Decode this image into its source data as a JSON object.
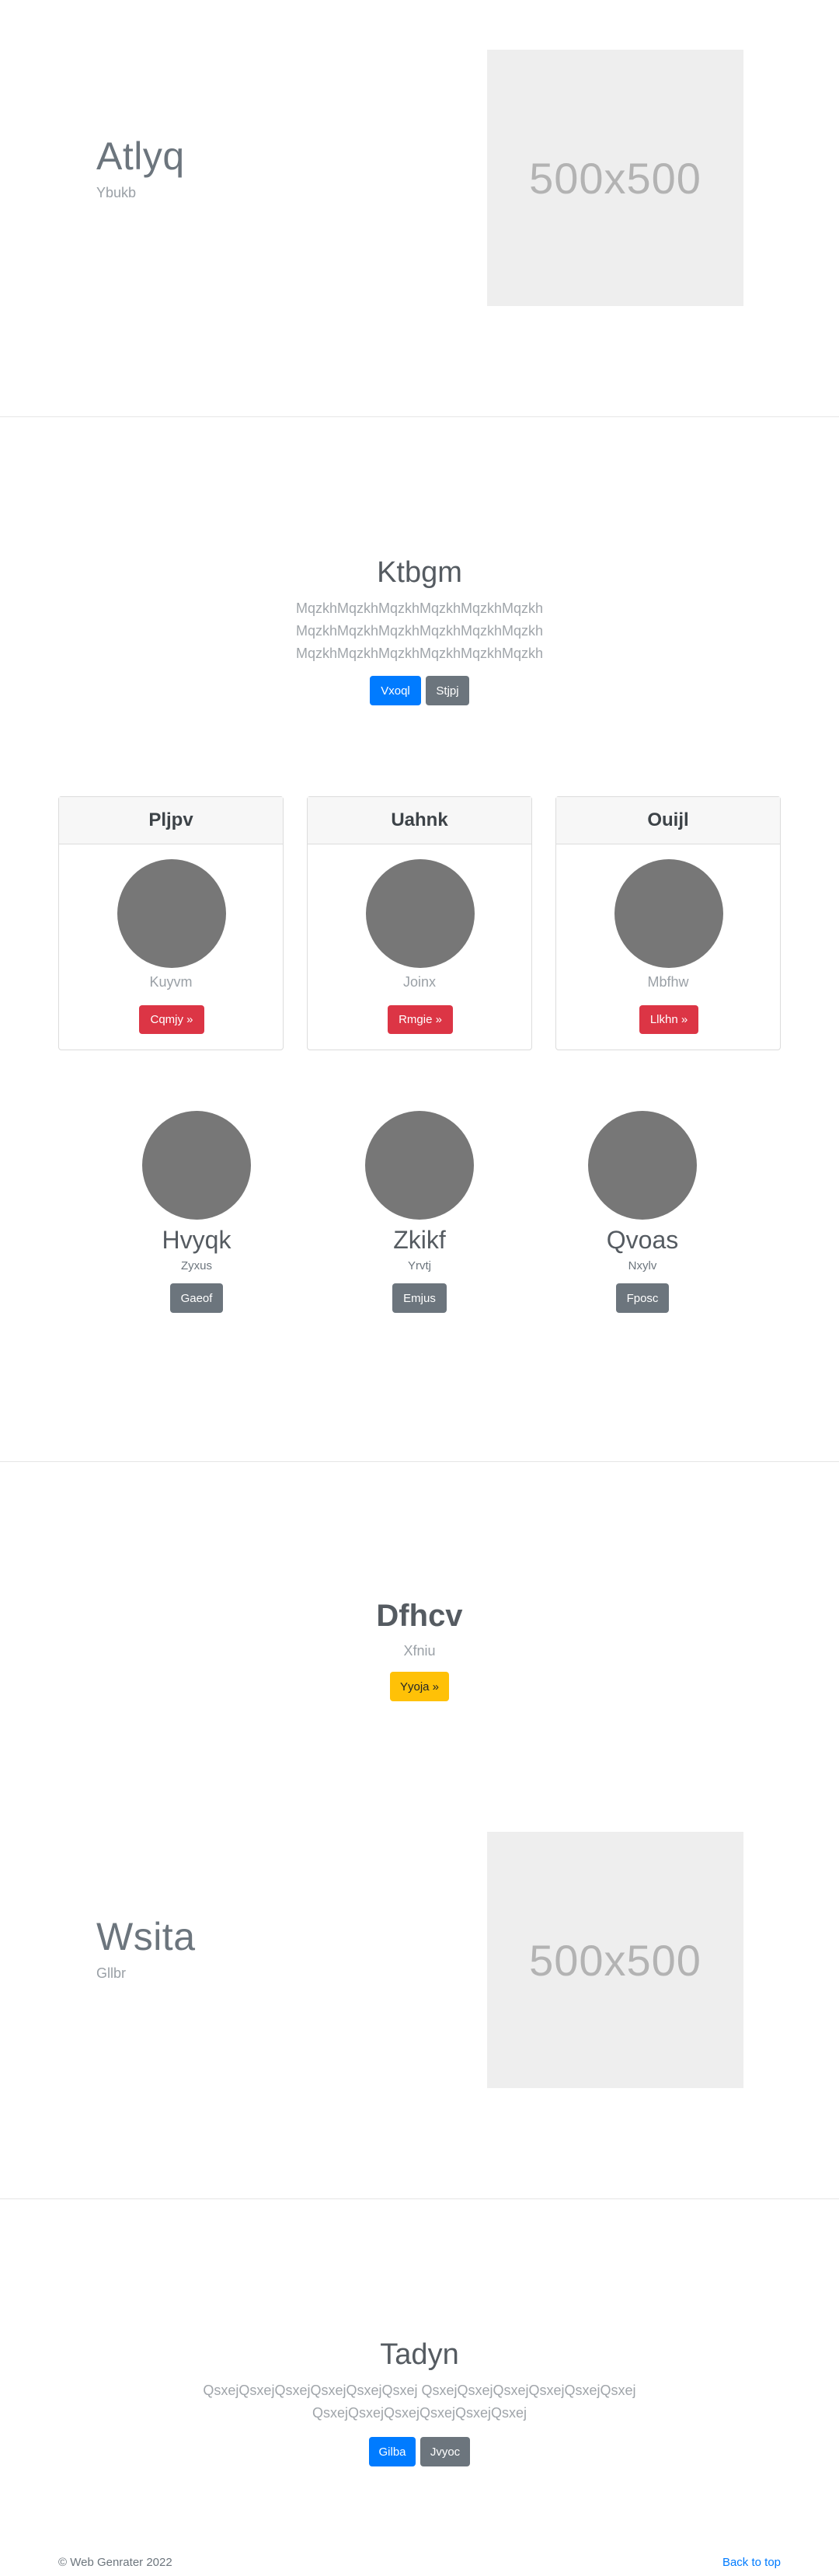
{
  "feature1": {
    "title": "Atlyq",
    "subtitle": "Ybukb",
    "image_label": "500x500"
  },
  "hero1": {
    "title": "Ktbgm",
    "lines": [
      "MqzkhMqzkhMqzkhMqzkhMqzkhMqzkh",
      "MqzkhMqzkhMqzkhMqzkhMqzkhMqzkh",
      "MqzkhMqzkhMqzkhMqzkhMqzkhMqzkh"
    ],
    "primary_button": "Vxoql",
    "secondary_button": "Stjpj"
  },
  "cards": [
    {
      "header": "Pljpv",
      "name": "Kuyvm",
      "button": "Cqmjy »"
    },
    {
      "header": "Uahnk",
      "name": "Joinx",
      "button": "Rmgie »"
    },
    {
      "header": "Ouijl",
      "name": "Mbfhw",
      "button": "Llkhn »"
    }
  ],
  "team": [
    {
      "name": "Hvyqk",
      "role": "Zyxus",
      "button": "Gaeof"
    },
    {
      "name": "Zkikf",
      "role": "Yrvtj",
      "button": "Emjus"
    },
    {
      "name": "Qvoas",
      "role": "Nxylv",
      "button": "Fposc"
    }
  ],
  "cta": {
    "title": "Dfhcv",
    "subtitle": "Xfniu",
    "button": "Yyoja »"
  },
  "feature2": {
    "title": "Wsita",
    "subtitle": "Gllbr",
    "image_label": "500x500"
  },
  "hero2": {
    "title": "Tadyn",
    "lines": [
      "QsxejQsxejQsxejQsxejQsxejQsxej QsxejQsxejQsxejQsxejQsxejQsxej",
      "QsxejQsxejQsxejQsxejQsxejQsxej"
    ],
    "primary_button": "Gilba",
    "secondary_button": "Jvyoc"
  },
  "footer": {
    "copyright": "© Web Genrater 2022",
    "back_to_top": "Back to top"
  },
  "colors": {
    "primary": "#007bff",
    "secondary": "#6c757d",
    "danger": "#dc3545",
    "warning": "#ffc107",
    "placeholder_bg": "#eeeeee",
    "circle": "#777777"
  }
}
